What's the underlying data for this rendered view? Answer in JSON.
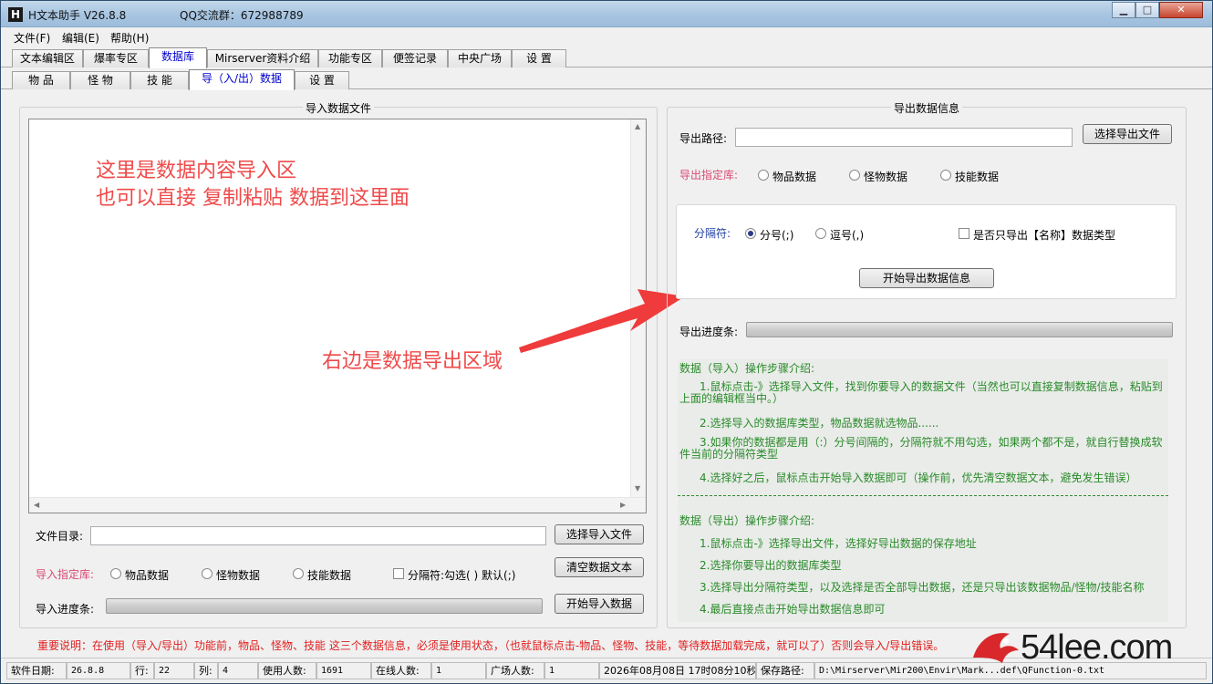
{
  "titlebar": {
    "app_icon": "H",
    "title": "H文本助手  V26.8.8",
    "qq": "QQ交流群：672988789"
  },
  "menu": [
    "文件(F)",
    "编辑(E)",
    "帮助(H)"
  ],
  "tabs_main": [
    "文本编辑区",
    "爆率专区",
    "数据库",
    "Mirserver资料介绍",
    "功能专区",
    "便签记录",
    "中央广场",
    "设  置"
  ],
  "tabs_sub": [
    "物 品",
    "怪 物",
    "技 能",
    "导（入/出）数据",
    "设 置"
  ],
  "import": {
    "group_title": "导入数据文件",
    "annotation_line1": "这里是数据内容导入区",
    "annotation_line2": "也可以直接 复制粘贴 数据到这里面",
    "annotation_right": "右边是数据导出区域",
    "file_dir_label": "文件目录:",
    "select_file_btn": "选择导入文件",
    "db_label": "导入指定库:",
    "radio_items": "物品数据",
    "radio_monsters": "怪物数据",
    "radio_skills": "技能数据",
    "separator_check": "分隔符:勾选( ) 默认(;)",
    "clear_btn": "清空数据文本",
    "progress_label": "导入进度条:",
    "start_btn": "开始导入数据"
  },
  "export": {
    "group_title": "导出数据信息",
    "path_label": "导出路径:",
    "select_file_btn": "选择导出文件",
    "db_label": "导出指定库:",
    "radio_items": "物品数据",
    "radio_monsters": "怪物数据",
    "radio_skills": "技能数据",
    "separator_label": "分隔符:",
    "radio_semicolon": "分号(;)",
    "radio_comma": "逗号(,)",
    "name_only_check": "是否只导出【名称】数据类型",
    "start_btn": "开始导出数据信息",
    "progress_label": "导出进度条:"
  },
  "info": {
    "import_title": "数据（导入）操作步骤介绍:",
    "import_steps": [
      "1.鼠标点击-》选择导入文件，找到你要导入的数据文件（当然也可以直接复制数据信息，粘贴到上面的编辑框当中。）",
      "2.选择导入的数据库类型，物品数据就选物品......",
      "3.如果你的数据都是用（:）分号间隔的，分隔符就不用勾选，如果两个都不是，就自行替换成软件当前的分隔符类型",
      "4.选择好之后，鼠标点击开始导入数据即可（操作前，优先清空数据文本，避免发生错误）"
    ],
    "export_title": "数据（导出）操作步骤介绍:",
    "export_steps": [
      "1.鼠标点击-》选择导出文件，选择好导出数据的保存地址",
      "2.选择你要导出的数据库类型",
      "3.选择导出分隔符类型，以及选择是否全部导出数据，还是只导出该数据物品/怪物/技能名称",
      "4.最后直接点击开始导出数据信息即可"
    ]
  },
  "notice": "重要说明：在使用（导入/导出）功能前，物品、怪物、技能 这三个数据信息，必须是使用状态，（也就鼠标点击-物品、怪物、技能，等待数据加载完成，就可以了）否则会导入/导出错误。",
  "status": {
    "date_label": "软件日期:",
    "date_value": "26.8.8",
    "row_label": "行:",
    "row_value": "22",
    "col_label": "列:",
    "col_value": "4",
    "users_label": "使用人数:",
    "users_value": "1691",
    "online_label": "在线人数:",
    "online_value": "1",
    "plaza_label": "广场人数:",
    "plaza_value": "1",
    "datetime": "2026年08月08日 17时08分10秒",
    "save_label": "保存路径:",
    "save_value": "D:\\Mirserver\\Mir200\\Envir\\Mark...def\\QFunction-0.txt"
  },
  "watermark": "54lee.com",
  "colors": {
    "annotation": "#ef4a4a",
    "info_text": "#2a8a2a",
    "label_pink": "#d94a74",
    "notice": "#e02020"
  }
}
